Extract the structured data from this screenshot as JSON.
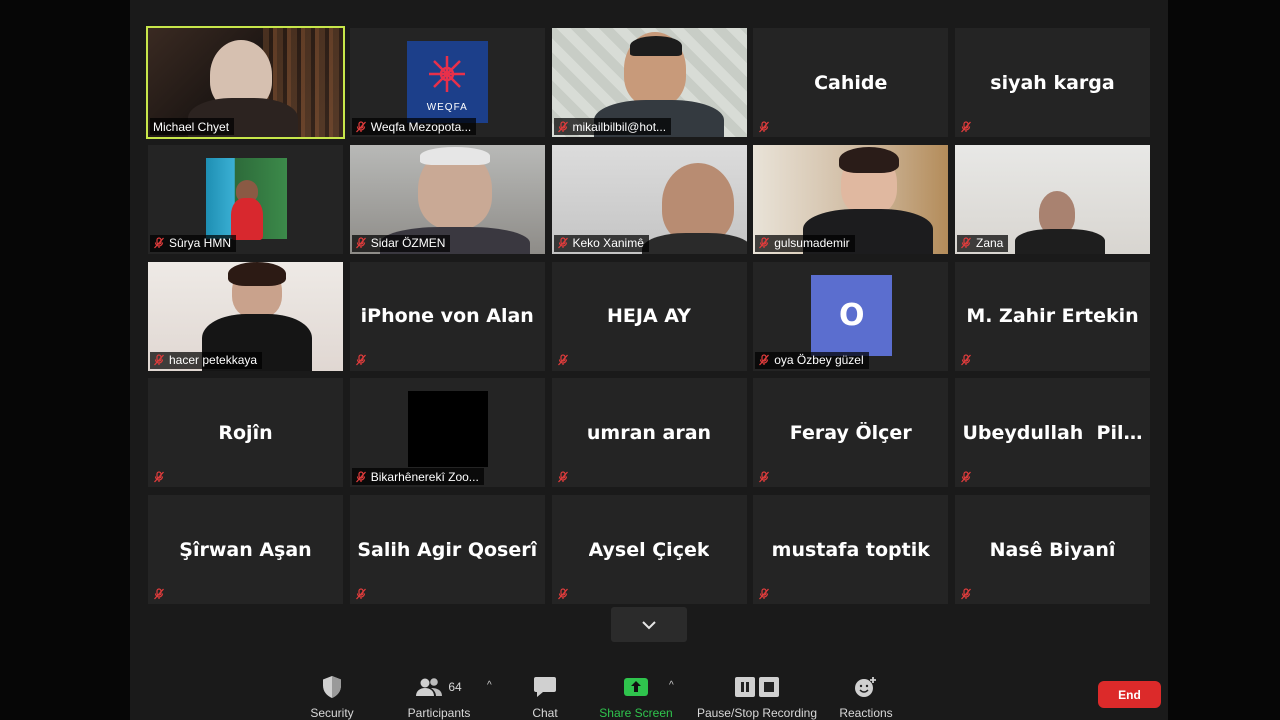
{
  "tiles": [
    {
      "name": "Michael Chyet",
      "type": "video",
      "active": true,
      "muted": false
    },
    {
      "name": "Weqfa Mezopota...",
      "type": "logo",
      "logo_text": "WEQFA",
      "muted": true
    },
    {
      "name": "mikailbilbil@hot...",
      "type": "video",
      "muted": true
    },
    {
      "name": "Cahide",
      "type": "name",
      "muted": true
    },
    {
      "name": "siyah karga",
      "type": "name",
      "muted": true
    },
    {
      "name": "Sûrya HMN",
      "type": "image",
      "muted": true
    },
    {
      "name": "Sidar ÖZMEN",
      "type": "video",
      "muted": true
    },
    {
      "name": "Keko Xanimê",
      "type": "video",
      "muted": true
    },
    {
      "name": "gulsumademir",
      "type": "video",
      "muted": true
    },
    {
      "name": "Zana",
      "type": "video",
      "muted": true
    },
    {
      "name": "hacer petekkaya",
      "type": "video",
      "muted": true
    },
    {
      "name": "iPhone von Alan",
      "type": "name",
      "muted": true
    },
    {
      "name": "HEJA AY",
      "type": "name",
      "muted": true
    },
    {
      "name": "oya Özbey güzel",
      "type": "avatar",
      "avatar_letter": "O",
      "avatar_color": "#5b6ecf",
      "muted": true
    },
    {
      "name": "M. Zahir Ertekin",
      "type": "name",
      "muted": true
    },
    {
      "name": "Rojîn",
      "type": "name",
      "muted": true
    },
    {
      "name": "Bikarhênerekî Zoo...",
      "type": "black",
      "muted": true
    },
    {
      "name": "umran aran",
      "type": "name",
      "muted": true
    },
    {
      "name": "Feray Ölçer",
      "type": "name",
      "muted": true
    },
    {
      "name": "Ubeydullah  Pila...",
      "type": "name",
      "muted": true
    },
    {
      "name": "Şîrwan Aşan",
      "type": "name",
      "muted": true
    },
    {
      "name": "Salih Agir Qoserî",
      "type": "name",
      "muted": true
    },
    {
      "name": "Aysel Çiçek",
      "type": "name",
      "muted": true
    },
    {
      "name": "mustafa toptik",
      "type": "name",
      "muted": true
    },
    {
      "name": "Nasê Biyanî",
      "type": "name",
      "muted": true
    }
  ],
  "toolbar": {
    "security_label": "Security",
    "participants_label": "Participants",
    "participants_count": "64",
    "chat_label": "Chat",
    "share_label": "Share Screen",
    "record_label": "Pause/Stop Recording",
    "reactions_label": "Reactions",
    "end_label": "End"
  },
  "colors": {
    "active_speaker": "#c7e64a",
    "share_green": "#2fc44d",
    "end_red": "#dc2a2a",
    "muted_red": "#e03c3c"
  },
  "icons": {
    "security": "shield-icon",
    "participants": "people-icon",
    "chat": "chat-bubble-icon",
    "share": "share-arrow-icon",
    "record": "pause-stop-icon",
    "reactions": "emoji-plus-icon",
    "more": "chevron-down-icon",
    "muted": "mic-off-icon"
  }
}
